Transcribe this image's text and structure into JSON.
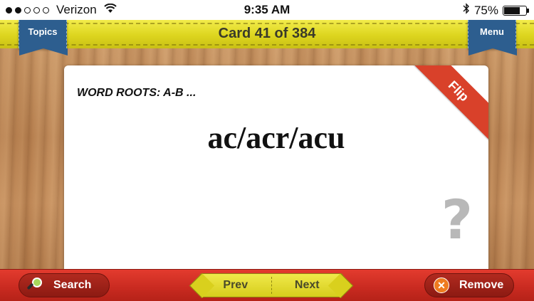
{
  "status_bar": {
    "carrier": "Verizon",
    "time": "9:35 AM",
    "battery": "75%",
    "battery_level": 0.75,
    "signal_bars": 2,
    "wifi_icon": "wifi-icon",
    "bluetooth_icon": "bluetooth-icon"
  },
  "header": {
    "title": "Card 41 of 384",
    "topics_label": "Topics",
    "menu_label": "Menu"
  },
  "card": {
    "topic": "WORD ROOTS: A-B ...",
    "term": "ac/acr/acu",
    "flip_label": "Flip",
    "hint_symbol": "?"
  },
  "bottom_bar": {
    "search_label": "Search",
    "prev_label": "Prev",
    "next_label": "Next",
    "remove_label": "Remove"
  },
  "colors": {
    "header_yellow": "#ddd51e",
    "ribbon_blue": "#2d5e8f",
    "flip_red": "#d9412a",
    "bottom_red": "#c82a20"
  }
}
